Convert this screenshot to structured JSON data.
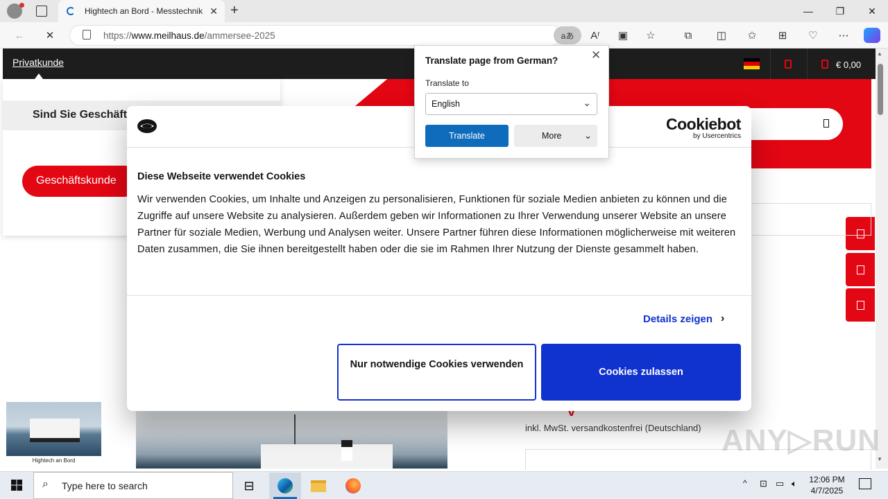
{
  "browser": {
    "tab_title": "Hightech an Bord - Messtechnik",
    "url_prefix": "https://",
    "url_host": "www.meilhaus.de",
    "url_path": "/ammersee-2025",
    "read_aloud_glyph": "Aʳ",
    "translate_glyph": "aあ"
  },
  "site": {
    "privat_label": "Privatkunde",
    "popover_heading": "Sind Sie Geschäftskunde?",
    "business_button": "Geschäftskunde",
    "cart_value": "€ 0,00",
    "price_note": "inkl. MwSt. versandkostenfrei (Deutschland)",
    "price_fragment": "y",
    "thumb_caption": "Hightech an Bord",
    "flag_colors": [
      "#000000",
      "#dd0000",
      "#ffce00"
    ],
    "accent_red": "#e30613"
  },
  "cookie": {
    "brand": "Cookiebot",
    "brand_sub": "by Usercentrics",
    "title": "Diese Webseite verwendet Cookies",
    "body": "Wir verwenden Cookies, um Inhalte und Anzeigen zu personalisieren, Funktionen für soziale Medien anbieten zu können und die Zugriffe auf unsere Website zu analysieren. Außerdem geben wir Informationen zu Ihrer Verwendung unserer Website an unsere Partner für soziale Medien, Werbung und Analysen weiter. Unsere Partner führen diese Informationen möglicherweise mit weiteren Daten zusammen, die Sie ihnen bereitgestellt haben oder die sie im Rahmen Ihrer Nutzung der Dienste gesammelt haben.",
    "details_label": "Details zeigen",
    "necessary_label": "Nur notwendige Cookies verwenden",
    "allow_label": "Cookies zulassen",
    "accent_blue": "#1032cf"
  },
  "translate_popup": {
    "title": "Translate page from German?",
    "to_label": "Translate to",
    "selected_language": "English",
    "translate_button": "Translate",
    "more_button": "More"
  },
  "watermark": "ANY▷RUN",
  "taskbar": {
    "search_placeholder": "Type here to search",
    "time": "12:06 PM",
    "date": "4/7/2025"
  }
}
